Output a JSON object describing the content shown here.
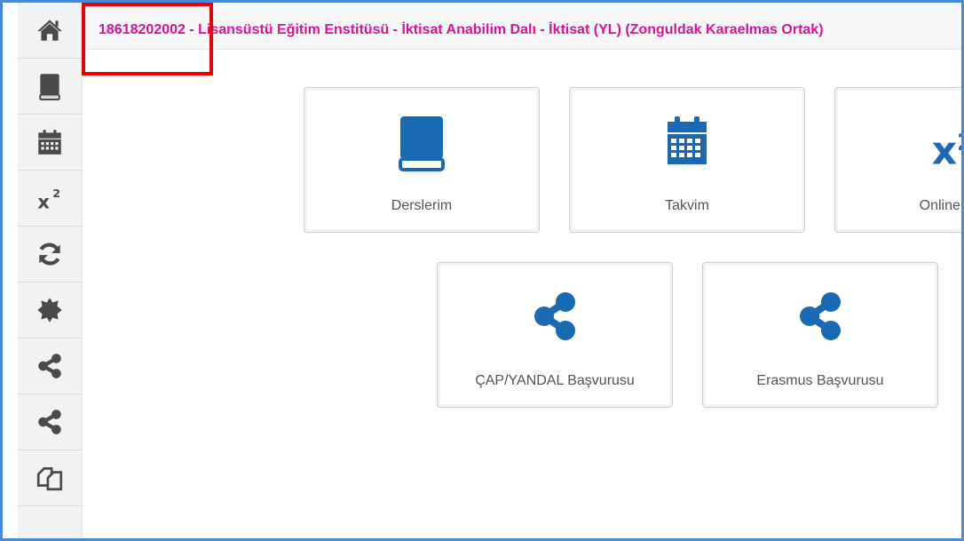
{
  "header": {
    "title": "18618202002 - Lisansüstü Eğitim Enstitüsü - İktisat Anabilim Dalı - İktisat (YL) (Zonguldak Karaelmas Ortak)"
  },
  "sidebar": {
    "items": [
      {
        "icon": "home-icon"
      },
      {
        "icon": "book-icon"
      },
      {
        "icon": "calendar-icon"
      },
      {
        "icon": "superscript-icon",
        "text": "x",
        "sup": "2"
      },
      {
        "icon": "refresh-icon"
      },
      {
        "icon": "badge-icon"
      },
      {
        "icon": "share-icon"
      },
      {
        "icon": "share-icon"
      },
      {
        "icon": "copy-icon"
      }
    ]
  },
  "tiles": [
    {
      "label": "Derslerim",
      "icon": "book-icon"
    },
    {
      "label": "Takvim",
      "icon": "calendar-icon"
    },
    {
      "label": "Online Sın",
      "icon": "superscript-icon",
      "text": "x",
      "sup": "2"
    },
    {
      "label": "ÇAP/YANDAL Başvurusu",
      "icon": "share-icon"
    },
    {
      "label": "Erasmus Başvurusu",
      "icon": "share-icon"
    }
  ],
  "colors": {
    "icon_blue": "#1a69b5",
    "sidebar_icon": "#4a4a4a",
    "title": "#d6139a",
    "highlight": "#ee0000",
    "frame": "#4a89d6"
  }
}
